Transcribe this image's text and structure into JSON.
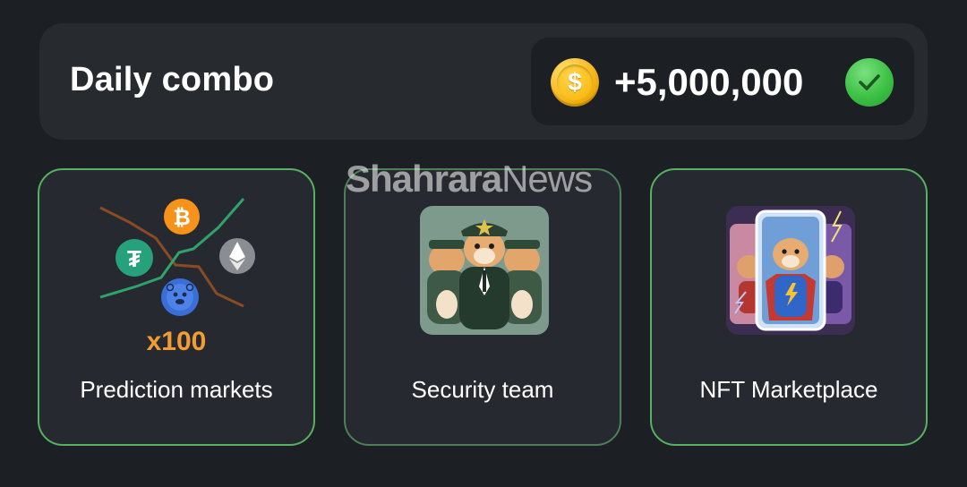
{
  "combo": {
    "title": "Daily combo",
    "reward": "+5,000,000",
    "coin_symbol": "$",
    "status": "completed"
  },
  "cards": [
    {
      "label": "Prediction markets",
      "multiplier": "x100",
      "icon": "prediction-markets-art"
    },
    {
      "label": "Security team",
      "icon": "security-team-hamsters"
    },
    {
      "label": "NFT Marketplace",
      "icon": "nft-marketplace-cards"
    }
  ],
  "watermark": {
    "strong": "Shahrara",
    "light": "News"
  },
  "colors": {
    "background": "#1c1f24",
    "panel": "#272a2f",
    "card_border": "#58b061",
    "check_green": "#3cc145",
    "coin_gold": "#fbc02d",
    "multiplier_orange": "#f39c34"
  }
}
